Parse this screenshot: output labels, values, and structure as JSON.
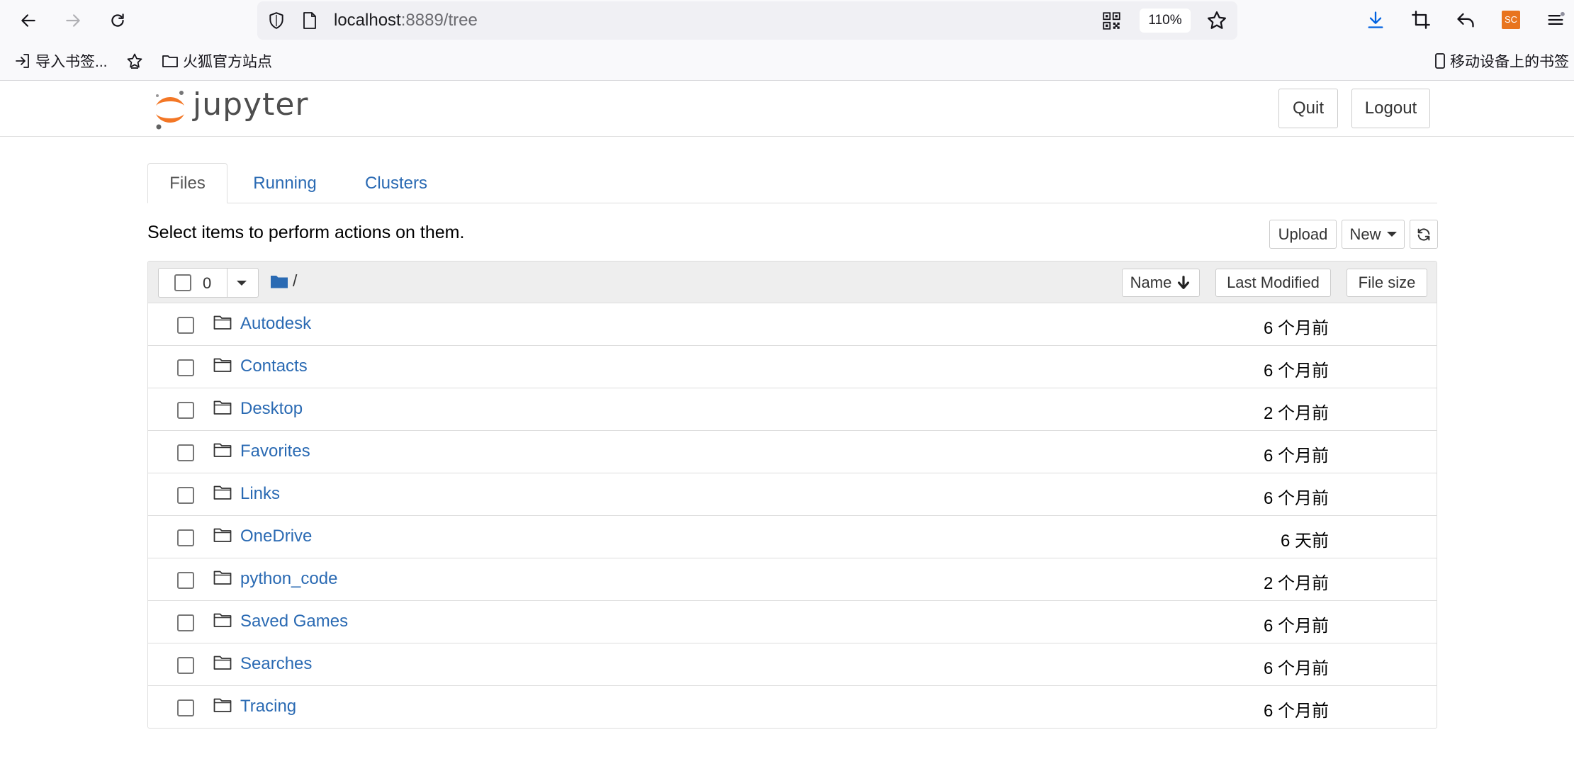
{
  "browser": {
    "url_host": "localhost",
    "url_rest": ":8889/tree",
    "zoom": "110%",
    "sc_badge": "SC",
    "bookmarks": {
      "import": "导入书签...",
      "firefox_site": "火狐官方站点",
      "mobile": "移动设备上的书签"
    },
    "icons": [
      "back-icon",
      "forward-icon",
      "reload-icon",
      "shield-icon",
      "page-icon",
      "qr-code-icon",
      "star-icon",
      "download-icon",
      "crop-icon",
      "undo-icon",
      "menu-icon"
    ]
  },
  "header": {
    "logo_text": "jupyter",
    "quit": "Quit",
    "logout": "Logout"
  },
  "tabs": [
    {
      "label": "Files",
      "active": true
    },
    {
      "label": "Running",
      "active": false
    },
    {
      "label": "Clusters",
      "active": false
    }
  ],
  "toolbar": {
    "hint": "Select items to perform actions on them.",
    "upload": "Upload",
    "new": "New"
  },
  "list_header": {
    "selected_count": "0",
    "breadcrumb": "/",
    "sort_name": "Name",
    "sort_modified": "Last Modified",
    "sort_size": "File size"
  },
  "files": [
    {
      "name": "Autodesk",
      "modified": "6 个月前"
    },
    {
      "name": "Contacts",
      "modified": "6 个月前"
    },
    {
      "name": "Desktop",
      "modified": "2 个月前"
    },
    {
      "name": "Favorites",
      "modified": "6 个月前"
    },
    {
      "name": "Links",
      "modified": "6 个月前"
    },
    {
      "name": "OneDrive",
      "modified": "6 天前"
    },
    {
      "name": "python_code",
      "modified": "2 个月前"
    },
    {
      "name": "Saved Games",
      "modified": "6 个月前"
    },
    {
      "name": "Searches",
      "modified": "6 个月前"
    },
    {
      "name": "Tracing",
      "modified": "6 个月前"
    }
  ],
  "colors": {
    "link": "#2a6ab3",
    "jupyter_orange": "#f37726",
    "folder_blue": "#2a6ab3"
  }
}
